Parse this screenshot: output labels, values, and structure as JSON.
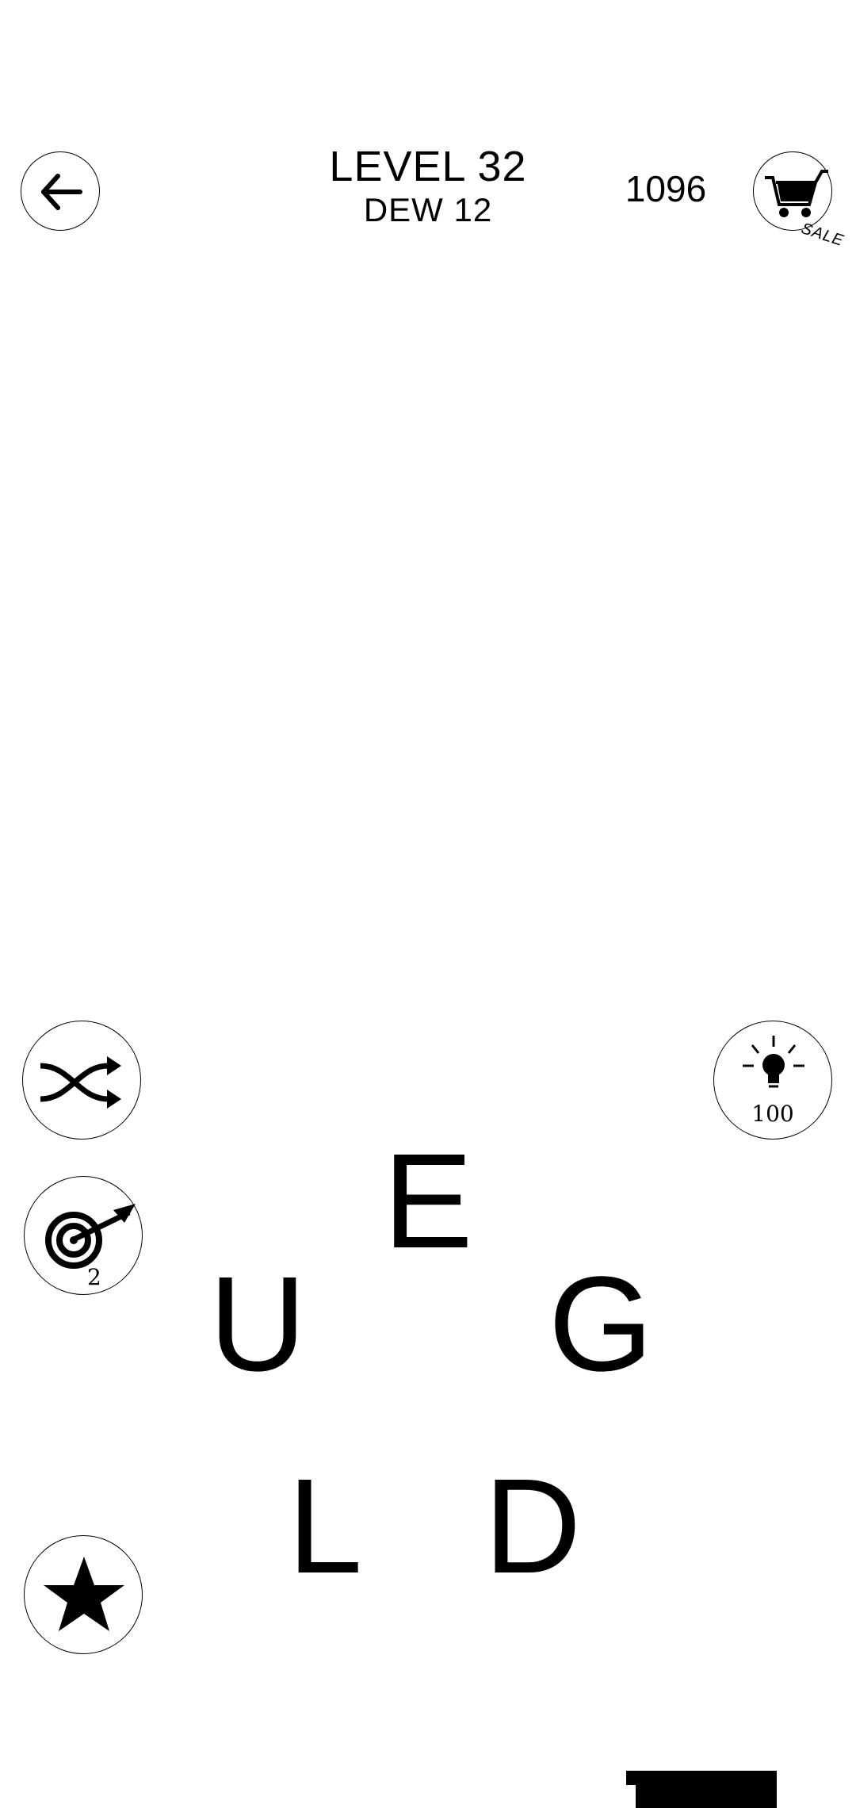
{
  "header": {
    "level_title": "LEVEL 32",
    "sub_title": "DEW 12",
    "coins": "1096",
    "shop_badge": "SALE"
  },
  "icons": {
    "back": "arrow-left-icon",
    "shop": "cart-icon",
    "shuffle": "shuffle-icon",
    "hint": "lightbulb-icon",
    "target": "target-icon",
    "star": "star-icon"
  },
  "tools": {
    "hint_count": "100",
    "target_count": "2"
  },
  "wheel": {
    "letters": [
      "E",
      "U",
      "G",
      "L",
      "D"
    ]
  }
}
